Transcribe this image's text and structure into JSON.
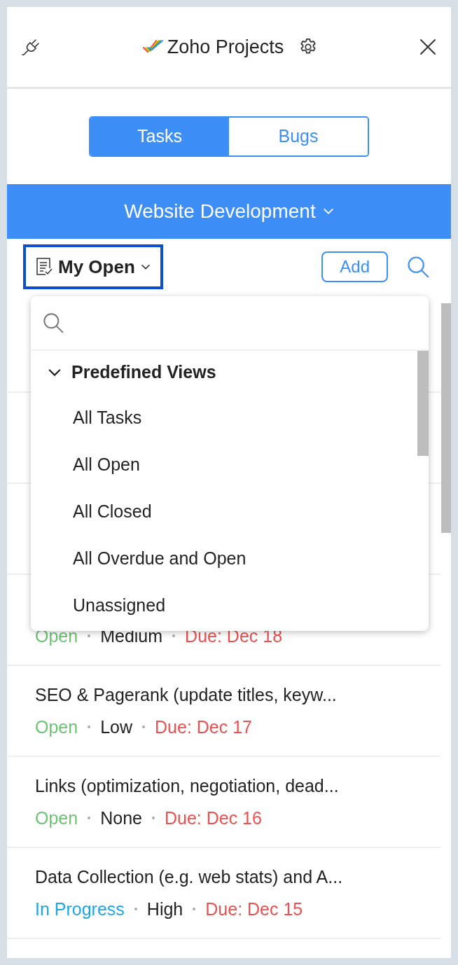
{
  "header": {
    "title": "Zoho Projects"
  },
  "tabs": [
    {
      "label": "Tasks",
      "selected": true
    },
    {
      "label": "Bugs",
      "selected": false
    }
  ],
  "project": {
    "name": "Website Development"
  },
  "toolbar": {
    "view": "My Open",
    "add_button": "Add"
  },
  "tasks": [
    {
      "status": "Open",
      "kind": "open",
      "priority": "Medium",
      "due": "Due: Dec 18"
    },
    {
      "title": "SEO & Pagerank (update titles, keyw...",
      "status": "Open",
      "kind": "open",
      "priority": "Low",
      "due": "Due: Dec 17"
    },
    {
      "title": "Links (optimization, negotiation, dead...",
      "status": "Open",
      "kind": "open",
      "priority": "None",
      "due": "Due: Dec 16"
    },
    {
      "title": "Data Collection (e.g. web stats) and A...",
      "status": "In Progress",
      "kind": "progress",
      "priority": "High",
      "due": "Due: Dec 15"
    }
  ],
  "view_menu": {
    "group": {
      "label": "Predefined Views",
      "expanded": true
    },
    "items": [
      "All Tasks",
      "All Open",
      "All Closed",
      "All Overdue and Open",
      "Unassigned"
    ]
  }
}
